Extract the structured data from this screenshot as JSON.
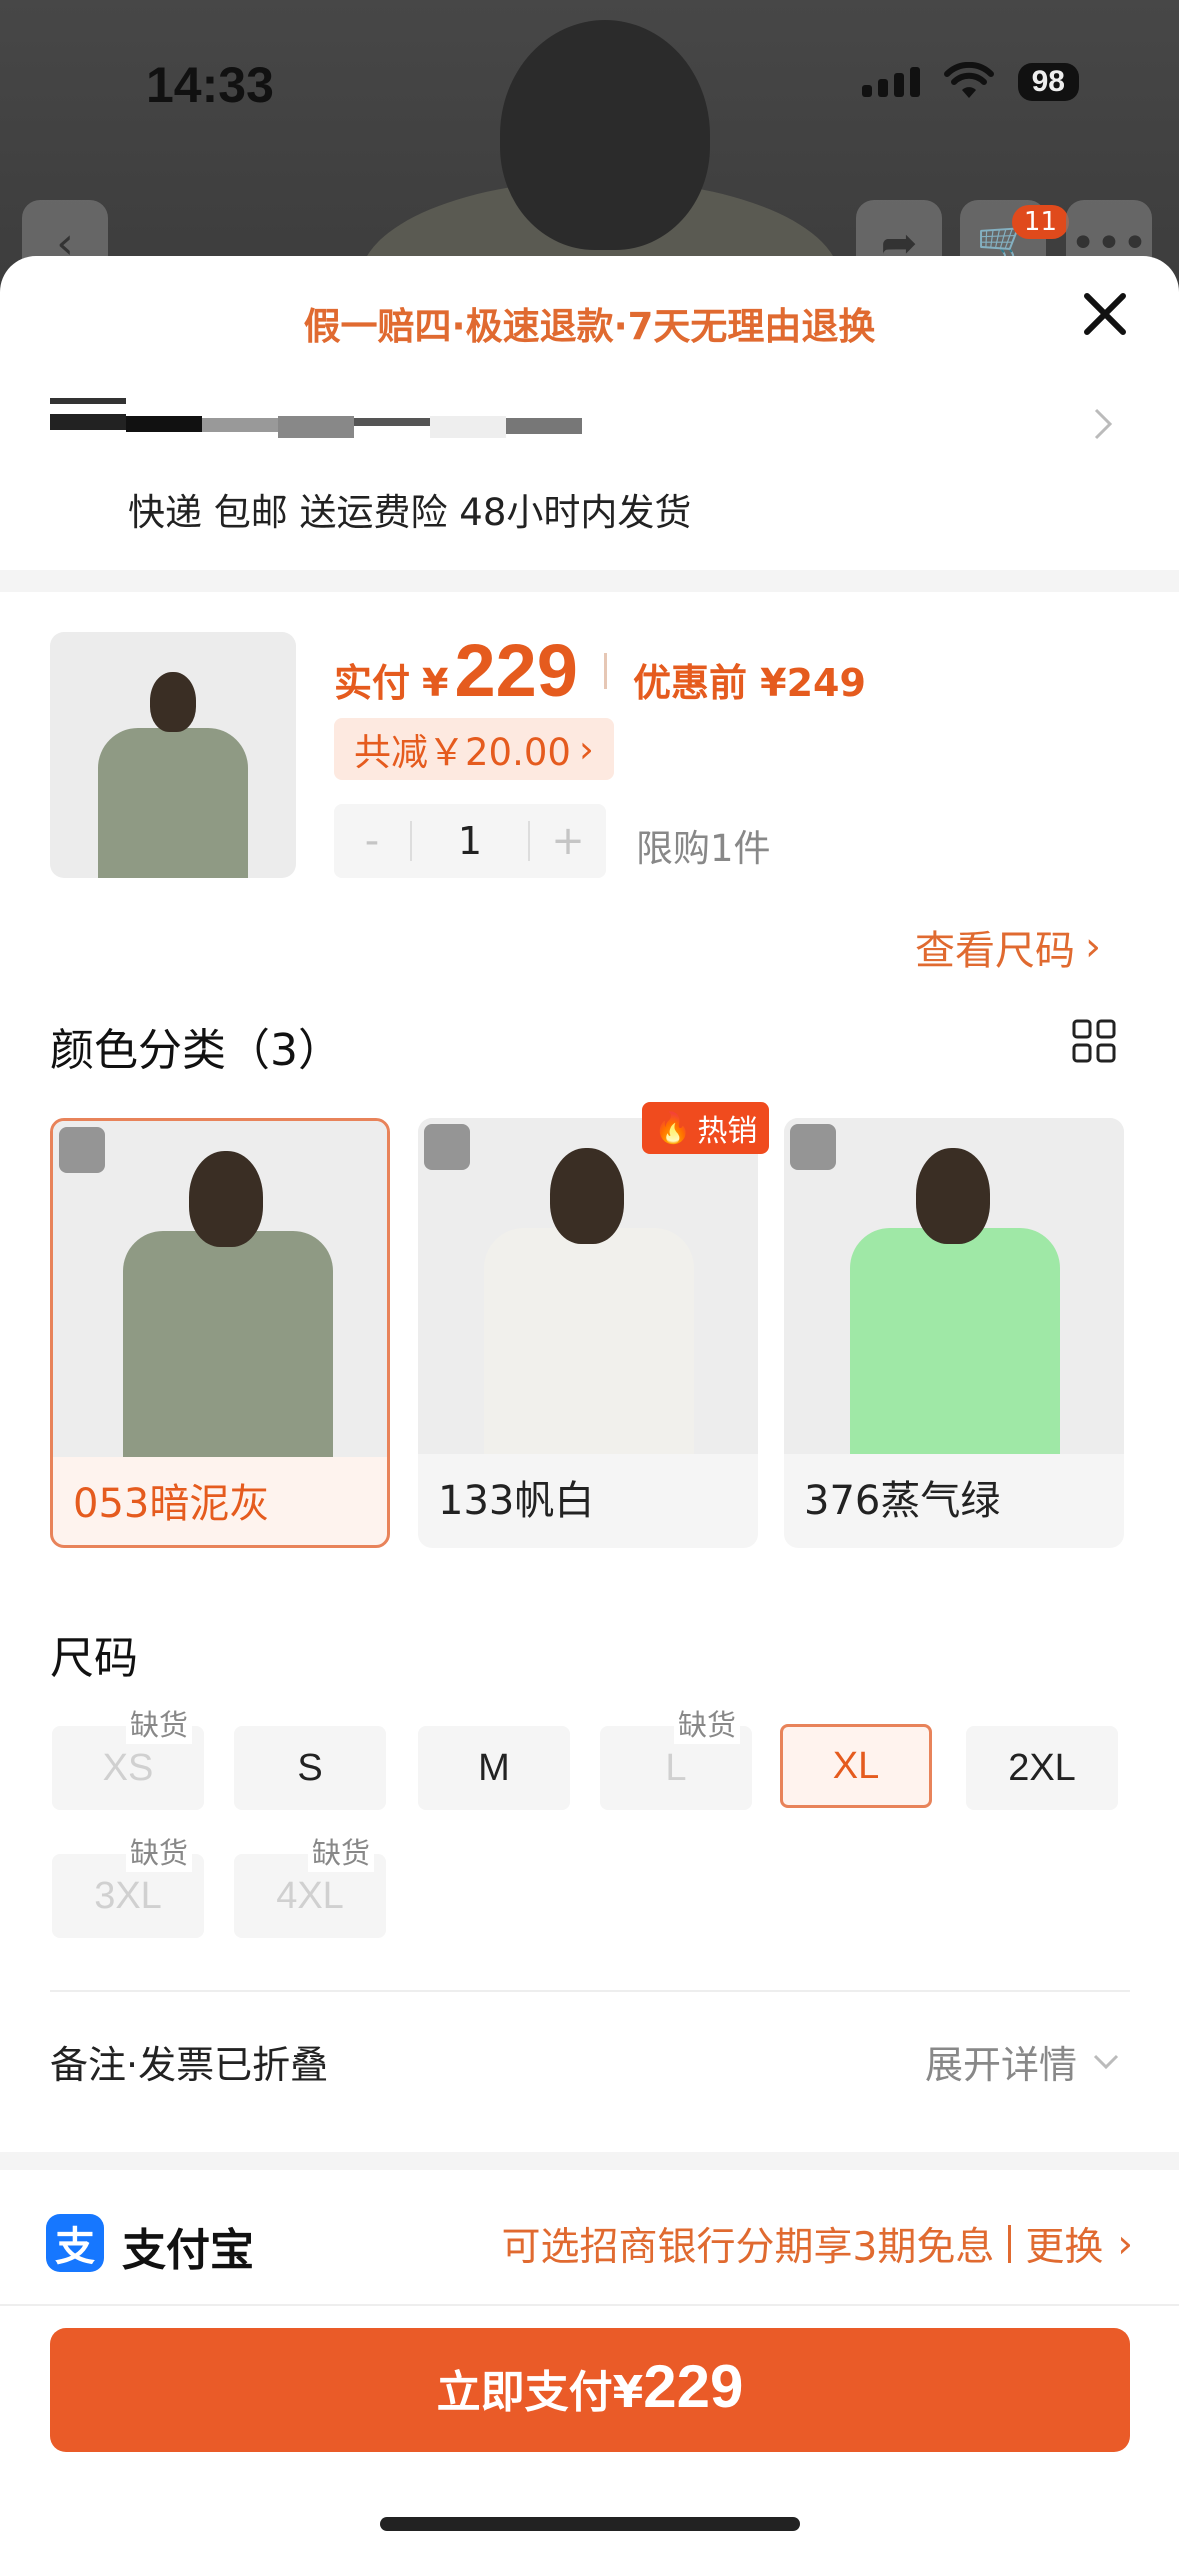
{
  "status": {
    "time": "14:33",
    "battery": "98"
  },
  "nav": {
    "cart_count": "11"
  },
  "sheet": {
    "banner": "假一赔四·极速退款·7天无理由退换",
    "shipping": "快递 包邮 送运费险 48小时内发货"
  },
  "product": {
    "price_label": "实付",
    "currency": "¥",
    "price": "229",
    "orig_label": "优惠前 ¥249",
    "discount": "共减￥20.00",
    "quantity": "1",
    "minus": "-",
    "plus": "+",
    "limit": "限购1件",
    "size_chart": "查看尺码"
  },
  "colors": {
    "title": "颜色分类（3）",
    "hot_badge": "热销",
    "items": [
      {
        "label": "053暗泥灰",
        "shirt": "#8f9a84"
      },
      {
        "label": "133帆白",
        "shirt": "#f1f0ec"
      },
      {
        "label": "376蒸气绿",
        "shirt": "#9fe8a6"
      }
    ]
  },
  "sizes": {
    "title": "尺码",
    "out_of_stock": "缺货",
    "items": [
      {
        "label": "XS",
        "available": false
      },
      {
        "label": "S",
        "available": true
      },
      {
        "label": "M",
        "available": true
      },
      {
        "label": "L",
        "available": false
      },
      {
        "label": "XL",
        "available": true,
        "selected": true
      },
      {
        "label": "2XL",
        "available": true
      },
      {
        "label": "3XL",
        "available": false
      },
      {
        "label": "4XL",
        "available": false
      }
    ]
  },
  "notes": {
    "label": "备注·发票已折叠",
    "expand": "展开详情"
  },
  "payment": {
    "alipay_glyph": "支",
    "method": "支付宝",
    "installment": "可选招商银行分期享3期免息",
    "change": "更换",
    "pay_label": "立即支付",
    "currency": "¥",
    "pay_amount": "229"
  },
  "colors_theme": {
    "accent": "#e55b1e",
    "button": "#ea5b28"
  }
}
